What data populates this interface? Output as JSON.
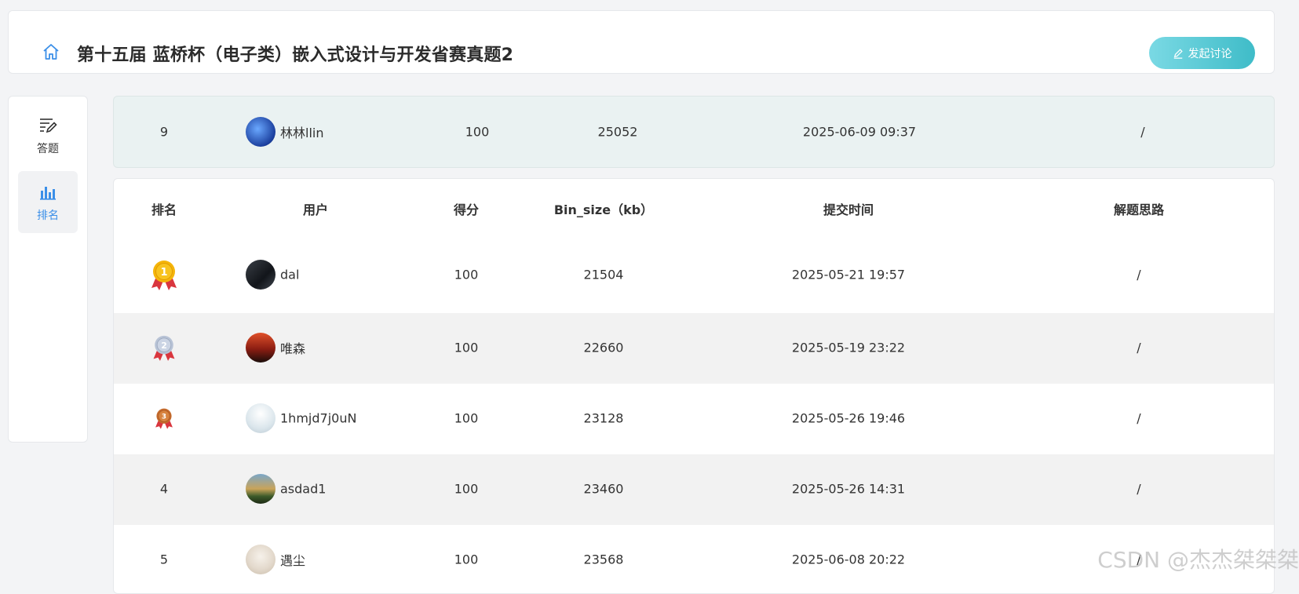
{
  "header": {
    "title": "第十五届 蓝桥杯（电子类）嵌入式设计与开发省赛真题2",
    "discuss_label": "发起讨论"
  },
  "sidebar": {
    "items": [
      {
        "label": "答题",
        "icon": "edit-list-icon"
      },
      {
        "label": "排名",
        "icon": "bar-chart-icon",
        "active": true
      }
    ]
  },
  "my_rank": {
    "rank": "9",
    "user": "林林llin",
    "score": "100",
    "bin_size": "25052",
    "time": "2025-06-09 09:37",
    "solution": "/"
  },
  "table": {
    "headers": [
      "排名",
      "用户",
      "得分",
      "Bin_size（kb）",
      "提交时间",
      "解题思路"
    ],
    "rows": [
      {
        "rank": "1",
        "user": "dal",
        "score": "100",
        "bin_size": "21504",
        "time": "2025-05-21 19:57",
        "solution": "/"
      },
      {
        "rank": "2",
        "user": "唯森",
        "score": "100",
        "bin_size": "22660",
        "time": "2025-05-19 23:22",
        "solution": "/"
      },
      {
        "rank": "3",
        "user": "1hmjd7j0uN",
        "score": "100",
        "bin_size": "23128",
        "time": "2025-05-26 19:46",
        "solution": "/"
      },
      {
        "rank": "4",
        "user": "asdad1",
        "score": "100",
        "bin_size": "23460",
        "time": "2025-05-26 14:31",
        "solution": "/"
      },
      {
        "rank": "5",
        "user": "遇尘",
        "score": "100",
        "bin_size": "23568",
        "time": "2025-06-08 20:22",
        "solution": "/"
      }
    ]
  },
  "watermark": "CSDN @杰杰桀桀桀",
  "colors": {
    "accent": "#3b8fe8",
    "button_start": "#7ad9e4",
    "button_end": "#3fbcc8",
    "highlight_row": "#eaf2f2"
  }
}
